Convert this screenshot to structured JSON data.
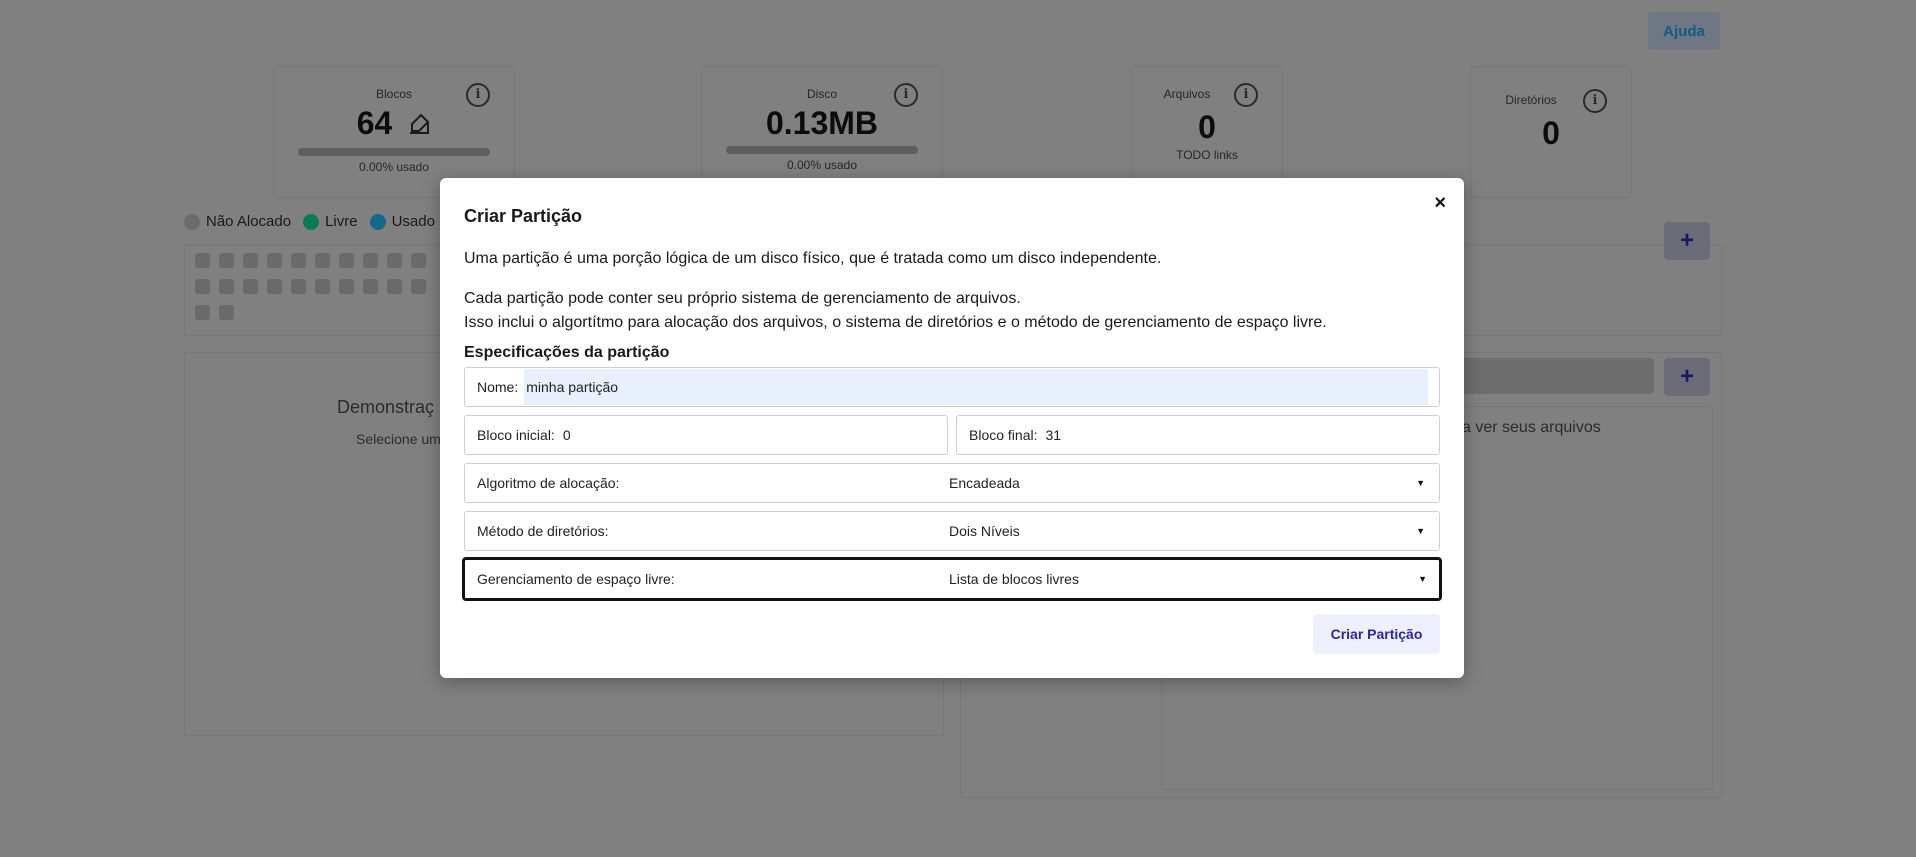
{
  "header": {
    "help_label": "Ajuda"
  },
  "stats": [
    {
      "label": "Blocos",
      "value": "64",
      "usage": "0.00% usado",
      "usage_fraction": 0
    },
    {
      "label": "Disco",
      "value": "0.13MB",
      "usage": "0.00% usado",
      "usage_fraction": 0
    },
    {
      "label": "Arquivos",
      "value": "0",
      "sub": "TODO links"
    },
    {
      "label": "Diretórios",
      "value": "0"
    }
  ],
  "legend": [
    {
      "label": "Não Alocado",
      "color": "#6b6b6b"
    },
    {
      "label": "Livre",
      "color": "#0a7a55"
    },
    {
      "label": "Usado",
      "color": "#0f6a8c"
    },
    {
      "label": "",
      "color": "#8a6a10"
    }
  ],
  "background": {
    "left_panel_title": "Demonstraç",
    "left_panel_sub": "Selecione um",
    "right_panel_text": "a ver seus arquivos",
    "plus_label": "+"
  },
  "modal": {
    "title": "Criar Partição",
    "close_label": "×",
    "paragraph1": "Uma partição é uma porção lógica de um disco físico, que é tratada como um disco independente.",
    "paragraph2": "Cada partição pode conter seu próprio sistema de gerenciamento de arquivos.",
    "paragraph3": "Isso inclui o algortítmo para alocação dos arquivos, o sistema de diretórios e o método de gerenciamento de espaço livre.",
    "section_title": "Especificações da partição",
    "name": {
      "label": "Nome:",
      "value": "minha partição"
    },
    "start_block": {
      "label": "Bloco inicial:",
      "value": "0"
    },
    "end_block": {
      "label": "Bloco final:",
      "value": "31"
    },
    "allocation": {
      "label": "Algoritmo de alocação:",
      "value": "Encadeada"
    },
    "directory": {
      "label": "Método de diretórios:",
      "value": "Dois Níveis"
    },
    "free_space": {
      "label": "Gerenciamento de espaço livre:",
      "value": "Lista de blocos livres"
    },
    "submit_label": "Criar Partição"
  }
}
